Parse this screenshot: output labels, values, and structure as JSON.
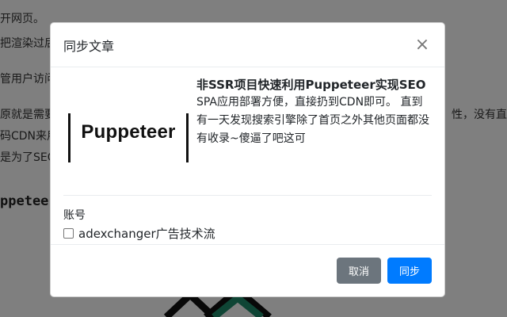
{
  "background": {
    "lines": [
      "开网页。",
      "把渲染过后",
      "管用户访问",
      "原就是需要",
      "码CDN来用",
      "是为了SEO"
    ],
    "right_fragment": "性，没有直",
    "heading": "ppeteer"
  },
  "modal": {
    "title": "同步文章",
    "close_symbol": "×",
    "article": {
      "thumbnail_text": "Puppeteer",
      "title": "非SSR项目快速利用Puppeteer实现SEO",
      "description": "SPA应用部署方便，直接扔到CDN即可。 直到有一天发现搜索引擎除了首页之外其他页面都没有收录~傻逼了吧这可"
    },
    "account": {
      "label": "账号",
      "options": [
        {
          "name": "adexchanger广告技术流",
          "checked": false
        }
      ]
    },
    "footer": {
      "cancel_label": "取消",
      "sync_label": "同步"
    }
  },
  "colors": {
    "primary": "#007bff",
    "secondary": "#6c757d",
    "backdrop": "rgba(0,0,0,0.5)",
    "graphic_green": "#1f8a6a"
  }
}
